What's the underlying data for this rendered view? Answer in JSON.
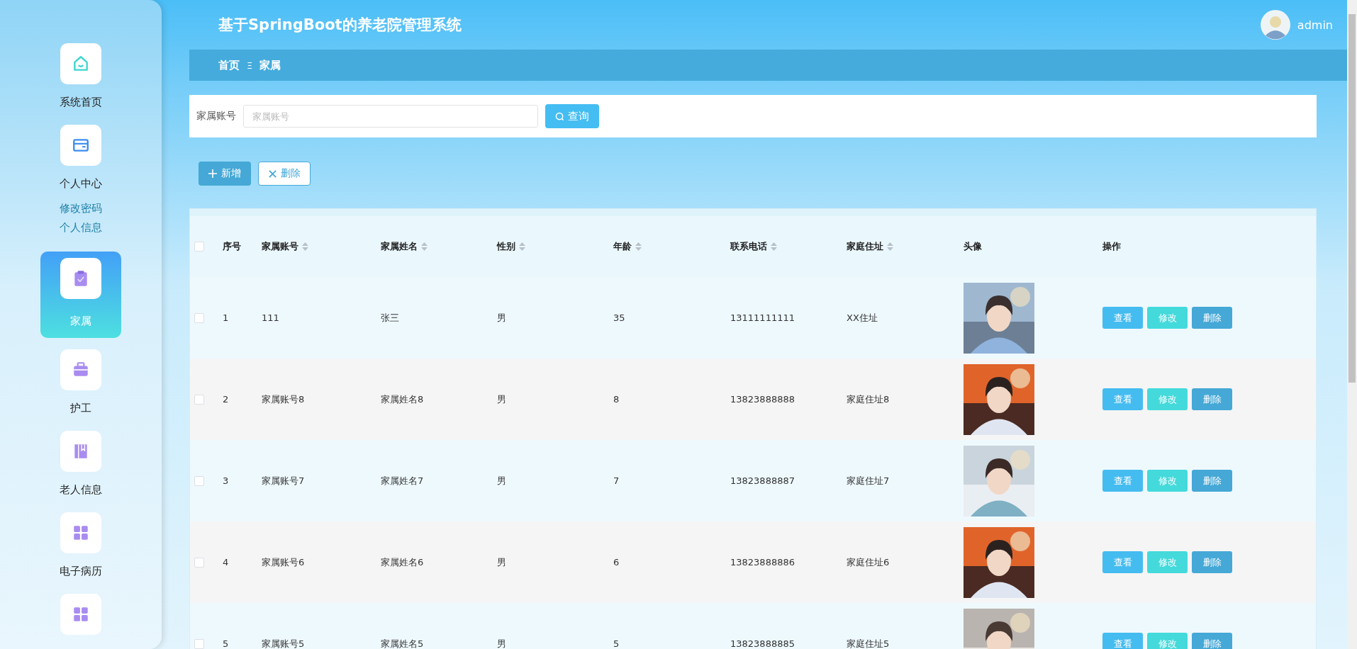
{
  "header": {
    "title": "基于SpringBoot的养老院管理系统",
    "user": "admin"
  },
  "breadcrumb": {
    "items": [
      "首页",
      "家属"
    ],
    "separator": "Ξ"
  },
  "sidebar": {
    "items": [
      {
        "label": "系统首页",
        "selected": false
      },
      {
        "label": "个人中心",
        "selected": false,
        "children": [
          {
            "label": "修改密码"
          },
          {
            "label": "个人信息"
          }
        ]
      },
      {
        "label": "家属",
        "selected": true
      },
      {
        "label": "护工",
        "selected": false
      },
      {
        "label": "老人信息",
        "selected": false
      },
      {
        "label": "电子病历",
        "selected": false
      },
      {
        "selected": false
      }
    ]
  },
  "search": {
    "label": "家属账号",
    "placeholder": "家属账号",
    "button": "查询"
  },
  "actions": [
    "新增",
    "删除"
  ],
  "table": {
    "header_checkbox": {
      "checked": false
    },
    "columns": [
      {
        "label": "序号"
      },
      {
        "label": "家属账号",
        "sortable": true
      },
      {
        "label": "家属姓名",
        "sortable": true
      },
      {
        "label": "性别",
        "sortable": true
      },
      {
        "label": "年龄",
        "sortable": true
      },
      {
        "label": "联系电话",
        "sortable": true
      },
      {
        "label": "家庭住址",
        "sortable": true
      },
      {
        "label": "头像"
      },
      {
        "label": "操作"
      }
    ],
    "rows": [
      {
        "checked": false,
        "cells": [
          "1",
          "111",
          "张三",
          "男",
          "35",
          "13111111111",
          "XX住址"
        ],
        "buttons": [
          "查看",
          "修改",
          "删除"
        ]
      },
      {
        "checked": false,
        "cells": [
          "2",
          "家属账号8",
          "家属姓名8",
          "男",
          "8",
          "13823888888",
          "家庭住址8"
        ],
        "buttons": [
          "查看",
          "修改",
          "删除"
        ]
      },
      {
        "checked": false,
        "cells": [
          "3",
          "家属账号7",
          "家属姓名7",
          "男",
          "7",
          "13823888887",
          "家庭住址7"
        ],
        "buttons": [
          "查看",
          "修改",
          "删除"
        ]
      },
      {
        "checked": false,
        "cells": [
          "4",
          "家属账号6",
          "家属姓名6",
          "男",
          "6",
          "13823888886",
          "家庭住址6"
        ],
        "buttons": [
          "查看",
          "修改",
          "删除"
        ]
      },
      {
        "checked": false,
        "cells": [
          "5",
          "家属账号5",
          "家属姓名5",
          "男",
          "5",
          "13823888885",
          "家庭住址5"
        ],
        "buttons": [
          "查看",
          "修改",
          "删除"
        ]
      }
    ]
  }
}
